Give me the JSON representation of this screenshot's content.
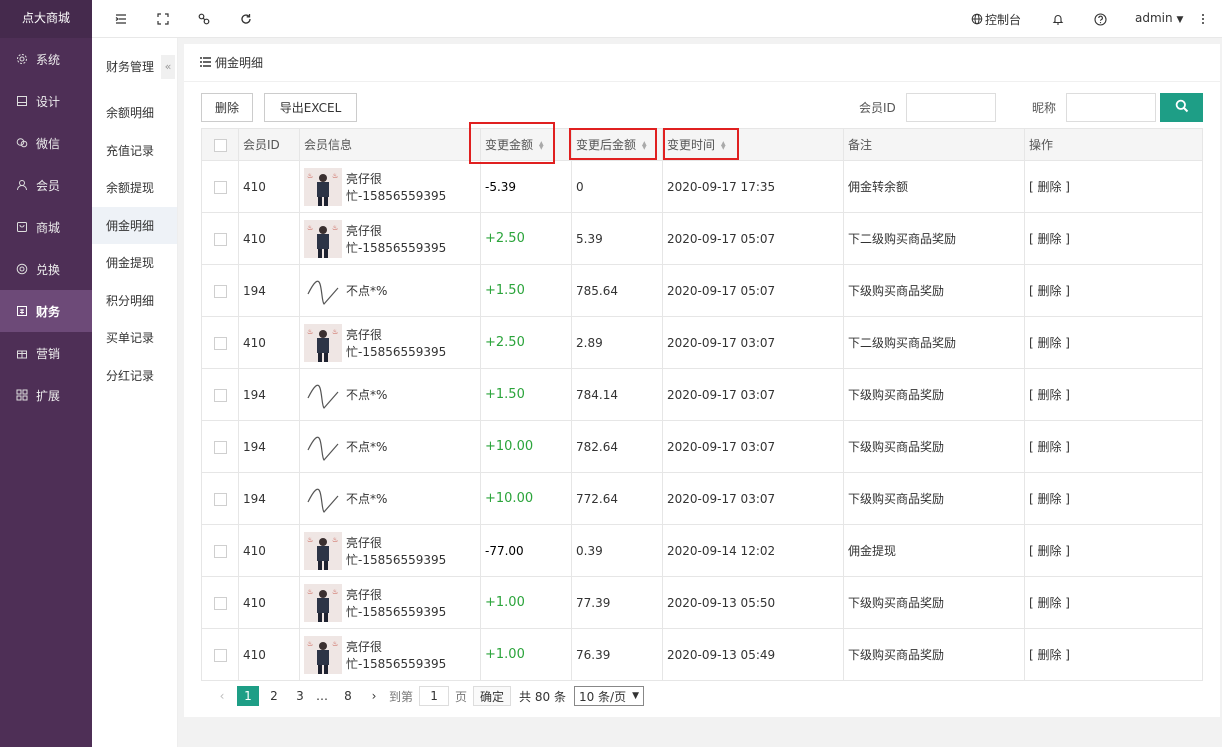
{
  "brand": "点大商城",
  "nav": [
    {
      "label": "系统",
      "icon": "gear-icon"
    },
    {
      "label": "设计",
      "icon": "monitor-icon"
    },
    {
      "label": "微信",
      "icon": "wechat-icon"
    },
    {
      "label": "会员",
      "icon": "user-icon"
    },
    {
      "label": "商城",
      "icon": "shop-icon"
    },
    {
      "label": "兑换",
      "icon": "exchange-icon"
    },
    {
      "label": "财务",
      "icon": "finance-icon",
      "active": true
    },
    {
      "label": "营销",
      "icon": "gift-icon"
    },
    {
      "label": "扩展",
      "icon": "grid-icon"
    }
  ],
  "subnav": {
    "title": "财务管理",
    "collapse": "«",
    "items": [
      "余额明细",
      "充值记录",
      "余额提现",
      "佣金明细",
      "佣金提现",
      "积分明细",
      "买单记录",
      "分红记录"
    ]
  },
  "topbar": {
    "console": "控制台",
    "user": "admin"
  },
  "page": {
    "title": "佣金明细",
    "delete_btn": "删除",
    "export_btn": "导出EXCEL",
    "member_id_label": "会员ID",
    "nickname_label": "昵称"
  },
  "table": {
    "headers": [
      "会员ID",
      "会员信息",
      "变更金额",
      "变更后金额",
      "变更时间",
      "备注",
      "操作"
    ],
    "rows": [
      {
        "id": "410",
        "name": "亮仔很忙-15856559395",
        "avatar": "photo",
        "amount": "-5.39",
        "after": "0",
        "time": "2020-09-17 17:35",
        "remark": "佣金转余额",
        "op": "[ 删除 ]"
      },
      {
        "id": "410",
        "name": "亮仔很忙-15856559395",
        "avatar": "photo",
        "amount": "+2.50",
        "after": "5.39",
        "time": "2020-09-17 05:07",
        "remark": "下二级购买商品奖励",
        "op": "[ 删除 ]"
      },
      {
        "id": "194",
        "name": "不点*%",
        "avatar": "sketch",
        "amount": "+1.50",
        "after": "785.64",
        "time": "2020-09-17 05:07",
        "remark": "下级购买商品奖励",
        "op": "[ 删除 ]"
      },
      {
        "id": "410",
        "name": "亮仔很忙-15856559395",
        "avatar": "photo",
        "amount": "+2.50",
        "after": "2.89",
        "time": "2020-09-17 03:07",
        "remark": "下二级购买商品奖励",
        "op": "[ 删除 ]"
      },
      {
        "id": "194",
        "name": "不点*%",
        "avatar": "sketch",
        "amount": "+1.50",
        "after": "784.14",
        "time": "2020-09-17 03:07",
        "remark": "下级购买商品奖励",
        "op": "[ 删除 ]"
      },
      {
        "id": "194",
        "name": "不点*%",
        "avatar": "sketch",
        "amount": "+10.00",
        "after": "782.64",
        "time": "2020-09-17 03:07",
        "remark": "下级购买商品奖励",
        "op": "[ 删除 ]"
      },
      {
        "id": "194",
        "name": "不点*%",
        "avatar": "sketch",
        "amount": "+10.00",
        "after": "772.64",
        "time": "2020-09-17 03:07",
        "remark": "下级购买商品奖励",
        "op": "[ 删除 ]"
      },
      {
        "id": "410",
        "name": "亮仔很忙-15856559395",
        "avatar": "photo",
        "amount": "-77.00",
        "after": "0.39",
        "time": "2020-09-14 12:02",
        "remark": "佣金提现",
        "op": "[ 删除 ]"
      },
      {
        "id": "410",
        "name": "亮仔很忙-15856559395",
        "avatar": "photo",
        "amount": "+1.00",
        "after": "77.39",
        "time": "2020-09-13 05:50",
        "remark": "下级购买商品奖励",
        "op": "[ 删除 ]"
      },
      {
        "id": "410",
        "name": "亮仔很忙-15856559395",
        "avatar": "photo",
        "amount": "+1.00",
        "after": "76.39",
        "time": "2020-09-13 05:49",
        "remark": "下级购买商品奖励",
        "op": "[ 删除 ]"
      }
    ]
  },
  "pager": {
    "prev": "‹",
    "pages": [
      "1",
      "2",
      "3"
    ],
    "ellipsis": "…",
    "last": "8",
    "next": "›",
    "goto_label": "到第",
    "goto_value": "1",
    "page_unit": "页",
    "confirm": "确定",
    "total": "共 80 条",
    "page_size": "10 条/页"
  }
}
